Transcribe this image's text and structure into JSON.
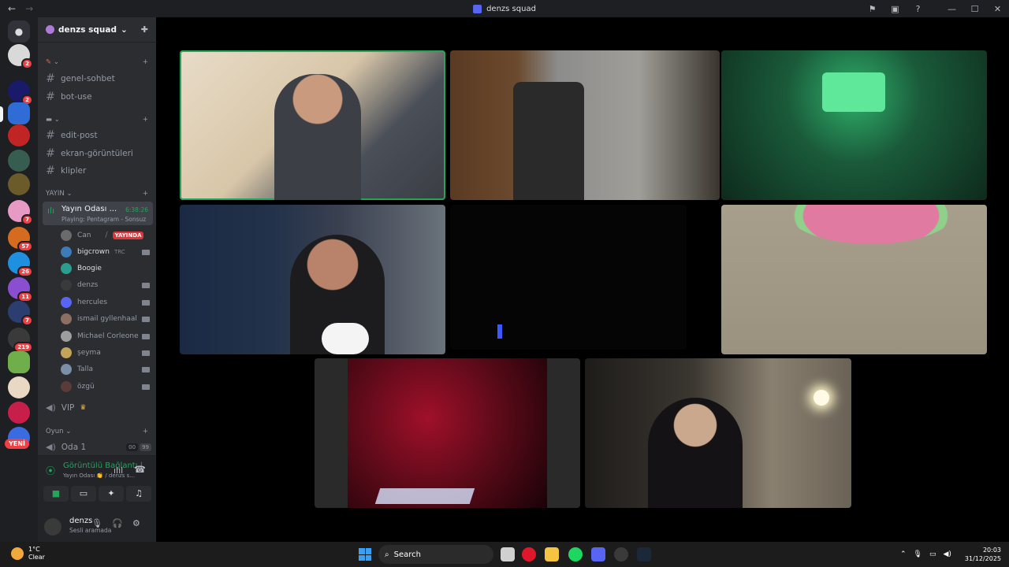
{
  "window": {
    "title": "denzs squad"
  },
  "server": {
    "name": "denzs squad"
  },
  "categories": [
    {
      "label": ""
    },
    {
      "label": ""
    },
    {
      "label": "YAYIN"
    },
    {
      "label": "Oyun"
    }
  ],
  "text_channels": [
    {
      "label": "genel-sohbet"
    },
    {
      "label": "bot-use"
    },
    {
      "label": "edit-post"
    },
    {
      "label": "ekran-görüntüleri"
    },
    {
      "label": "klipler"
    }
  ],
  "active_voice": {
    "name": "Yayın Odası ...",
    "time": "6:38:26",
    "activity": "Playing: Pentagram - Sonsuz"
  },
  "voice_users": [
    {
      "name": "Can",
      "badge": "YAYINDA",
      "color": "#6b6b6b"
    },
    {
      "name": "bigcrown",
      "extra": "TRC",
      "color": "#3d7ab8"
    },
    {
      "name": "Boogie",
      "color": "#2a9d8f"
    },
    {
      "name": "denzs",
      "color": "#3a3a3a"
    },
    {
      "name": "hercules",
      "color": "#5865f2"
    },
    {
      "name": "ismail gyllenhaal",
      "color": "#8d6e63"
    },
    {
      "name": "Michael Corleone",
      "color": "#9e9e9e"
    },
    {
      "name": "şeyma",
      "color": "#c4a35a"
    },
    {
      "name": "Talla",
      "color": "#7b8fa6"
    },
    {
      "name": "özgü",
      "color": "#5b3a3a"
    }
  ],
  "voice_channels": [
    {
      "label": "VIP"
    },
    {
      "label": "Oda 1",
      "counts": [
        "00",
        "99"
      ]
    }
  ],
  "voice_panel": {
    "status": "Görüntülü Bağlantı |",
    "sub": "Yayın Odası 👏 / denzs s..."
  },
  "user": {
    "name": "denzs",
    "status": "Sesli aramada"
  },
  "guild_badges": [
    "2",
    "2",
    "",
    "",
    "",
    "",
    "7",
    "57",
    "26",
    "11",
    "7",
    "219",
    "",
    "",
    ""
  ],
  "new_label": "YENİ",
  "taskbar": {
    "weather_temp": "1°C",
    "weather_desc": "Clear",
    "search_label": "Search",
    "time": "20:03",
    "date": "31/12/2025"
  },
  "colors": {
    "speaking": "#23a55a",
    "accent": "#5865f2",
    "danger": "#da373c"
  }
}
